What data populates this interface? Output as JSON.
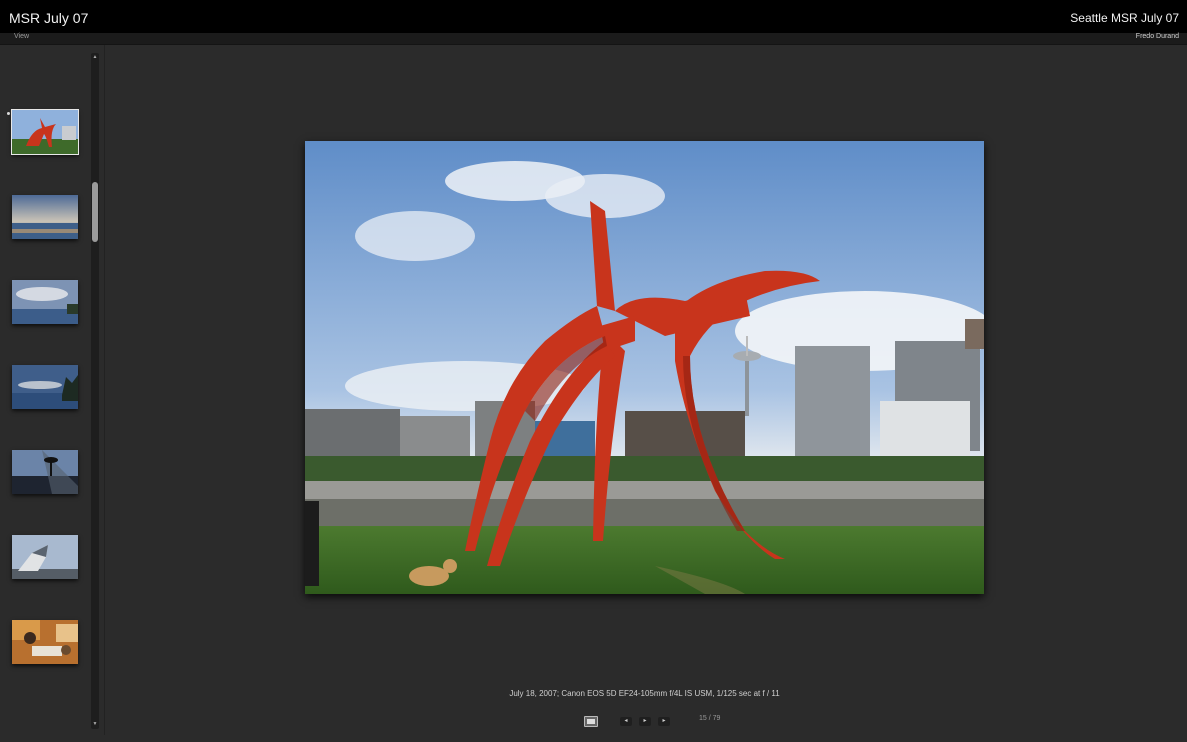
{
  "header": {
    "app_title": "MSR July 07",
    "gallery_title": "Seattle MSR July 07",
    "menu_view": "View",
    "author": "Fredo Durand"
  },
  "filmstrip": {
    "thumbnails": [
      {
        "subject": "red sculpture",
        "selected": true
      },
      {
        "subject": "sunset clouds over water",
        "selected": false
      },
      {
        "subject": "clouds over bay",
        "selected": false
      },
      {
        "subject": "dusk over water with trees",
        "selected": false
      },
      {
        "subject": "road with tree silhouette",
        "selected": false
      },
      {
        "subject": "angular sculpture",
        "selected": false
      },
      {
        "subject": "people at dinner table",
        "selected": false
      }
    ]
  },
  "viewer": {
    "caption": "July 18, 2007; Canon EOS 5D EF24-105mm f/4L IS USM, 1/125 sec at f / 11",
    "counter": "15 / 79",
    "controls": {
      "prev_icon": "◂",
      "play_icon": "▸",
      "next_icon": "▸"
    }
  },
  "colors": {
    "background": "#2b2b2b",
    "topbar": "#000000",
    "sculpture_red": "#c8341c",
    "sky": "#7ea3d2"
  }
}
